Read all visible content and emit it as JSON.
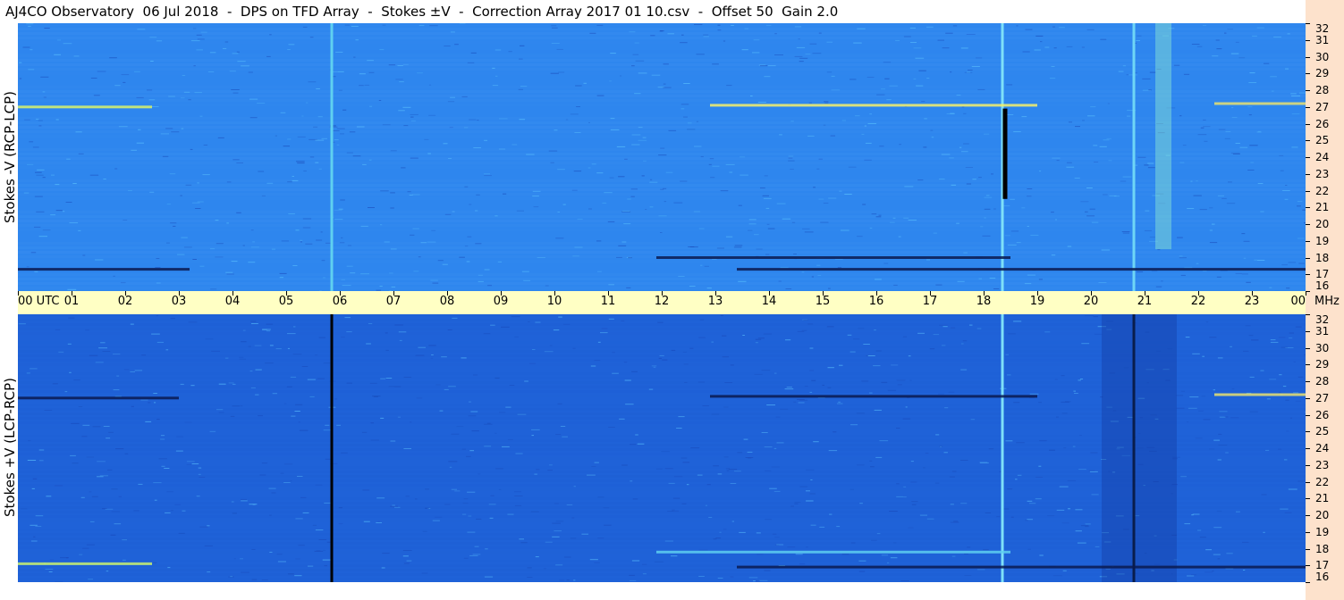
{
  "title": "AJ4CO Observatory  06 Jul 2018  -  DPS on TFD Array  -  Stokes ±V  -  Correction Array 2017 01 10.csv  -  Offset 50  Gain 2.0",
  "chart_data": [
    {
      "type": "heatmap",
      "panel": "top",
      "ylabel": "Stokes -V (RCP-LCP)",
      "x_tick_labels": [
        "00 UTC",
        "01",
        "02",
        "03",
        "04",
        "05",
        "06",
        "07",
        "08",
        "09",
        "10",
        "11",
        "12",
        "13",
        "14",
        "15",
        "16",
        "17",
        "18",
        "19",
        "20",
        "21",
        "22",
        "23",
        "00"
      ],
      "x_unit": "MHz",
      "y_tick_labels": [
        "32",
        "31",
        "30",
        "29",
        "28",
        "27",
        "26",
        "25",
        "24",
        "23",
        "22",
        "21",
        "20",
        "19",
        "18",
        "17",
        "16"
      ],
      "xlim": [
        0,
        24
      ],
      "ylim": [
        16,
        32
      ],
      "background_color": "#2e86ee",
      "features": [
        {
          "kind": "vertical-line",
          "utc": 5.85,
          "color": "#5fd0f0"
        },
        {
          "kind": "vertical-line",
          "utc": 20.8,
          "color": "#6fd6f6"
        },
        {
          "kind": "vertical-line",
          "utc": 18.35,
          "color": "#7ee0f8"
        },
        {
          "kind": "vertical-segment",
          "utc": 18.4,
          "from_mhz": 21.5,
          "to_mhz": 26.9,
          "color": "#000000"
        },
        {
          "kind": "vertical-band",
          "from_utc": 21.2,
          "to_utc": 21.5,
          "from_mhz": 18.5,
          "to_mhz": 32,
          "color": "#8fe8d0"
        },
        {
          "kind": "horizontal-streak",
          "from_utc": 12.9,
          "to_utc": 19.0,
          "mhz": 27.1,
          "color": "#f6f06a"
        },
        {
          "kind": "horizontal-streak",
          "from_utc": 0.0,
          "to_utc": 2.5,
          "mhz": 27.0,
          "color": "#d8f26a"
        },
        {
          "kind": "horizontal-streak",
          "from_utc": 22.3,
          "to_utc": 24.0,
          "mhz": 27.2,
          "color": "#e8e070"
        },
        {
          "kind": "horizontal-streak",
          "from_utc": 0.0,
          "to_utc": 3.2,
          "mhz": 17.3,
          "color": "#0a1a50"
        },
        {
          "kind": "horizontal-streak",
          "from_utc": 11.9,
          "to_utc": 18.5,
          "mhz": 18.0,
          "color": "#0a1a50"
        },
        {
          "kind": "horizontal-streak",
          "from_utc": 13.4,
          "to_utc": 24.0,
          "mhz": 17.3,
          "color": "#0a1a50"
        }
      ]
    },
    {
      "type": "heatmap",
      "panel": "bottom",
      "ylabel": "Stokes +V (LCP-RCP)",
      "x_tick_labels": [
        "00 UTC",
        "01",
        "02",
        "03",
        "04",
        "05",
        "06",
        "07",
        "08",
        "09",
        "10",
        "11",
        "12",
        "13",
        "14",
        "15",
        "16",
        "17",
        "18",
        "19",
        "20",
        "21",
        "22",
        "23",
        "00"
      ],
      "x_unit": "MHz",
      "y_tick_labels": [
        "32",
        "31",
        "30",
        "29",
        "28",
        "27",
        "26",
        "25",
        "24",
        "23",
        "22",
        "21",
        "20",
        "19",
        "18",
        "17",
        "16"
      ],
      "xlim": [
        0,
        24
      ],
      "ylim": [
        16,
        32
      ],
      "background_color": "#1f62d8",
      "features": [
        {
          "kind": "vertical-line",
          "utc": 5.85,
          "color": "#000000"
        },
        {
          "kind": "vertical-line",
          "utc": 20.8,
          "color": "#000000"
        },
        {
          "kind": "vertical-line",
          "utc": 18.35,
          "color": "#7ee0f8"
        },
        {
          "kind": "vertical-band",
          "from_utc": 20.2,
          "to_utc": 21.6,
          "from_mhz": 16,
          "to_mhz": 32,
          "color": "#1540a8"
        },
        {
          "kind": "horizontal-streak",
          "from_utc": 12.9,
          "to_utc": 19.0,
          "mhz": 27.1,
          "color": "#0a1a50"
        },
        {
          "kind": "horizontal-streak",
          "from_utc": 0.0,
          "to_utc": 3.0,
          "mhz": 27.0,
          "color": "#0a1a50"
        },
        {
          "kind": "horizontal-streak",
          "from_utc": 22.3,
          "to_utc": 24.0,
          "mhz": 27.2,
          "color": "#e8e070"
        },
        {
          "kind": "horizontal-streak",
          "from_utc": 0.0,
          "to_utc": 2.5,
          "mhz": 17.1,
          "color": "#c8f070"
        },
        {
          "kind": "horizontal-streak",
          "from_utc": 11.9,
          "to_utc": 18.5,
          "mhz": 17.8,
          "color": "#5fd0f0"
        },
        {
          "kind": "horizontal-streak",
          "from_utc": 13.4,
          "to_utc": 24.0,
          "mhz": 16.9,
          "color": "#0a1a50"
        }
      ]
    }
  ]
}
